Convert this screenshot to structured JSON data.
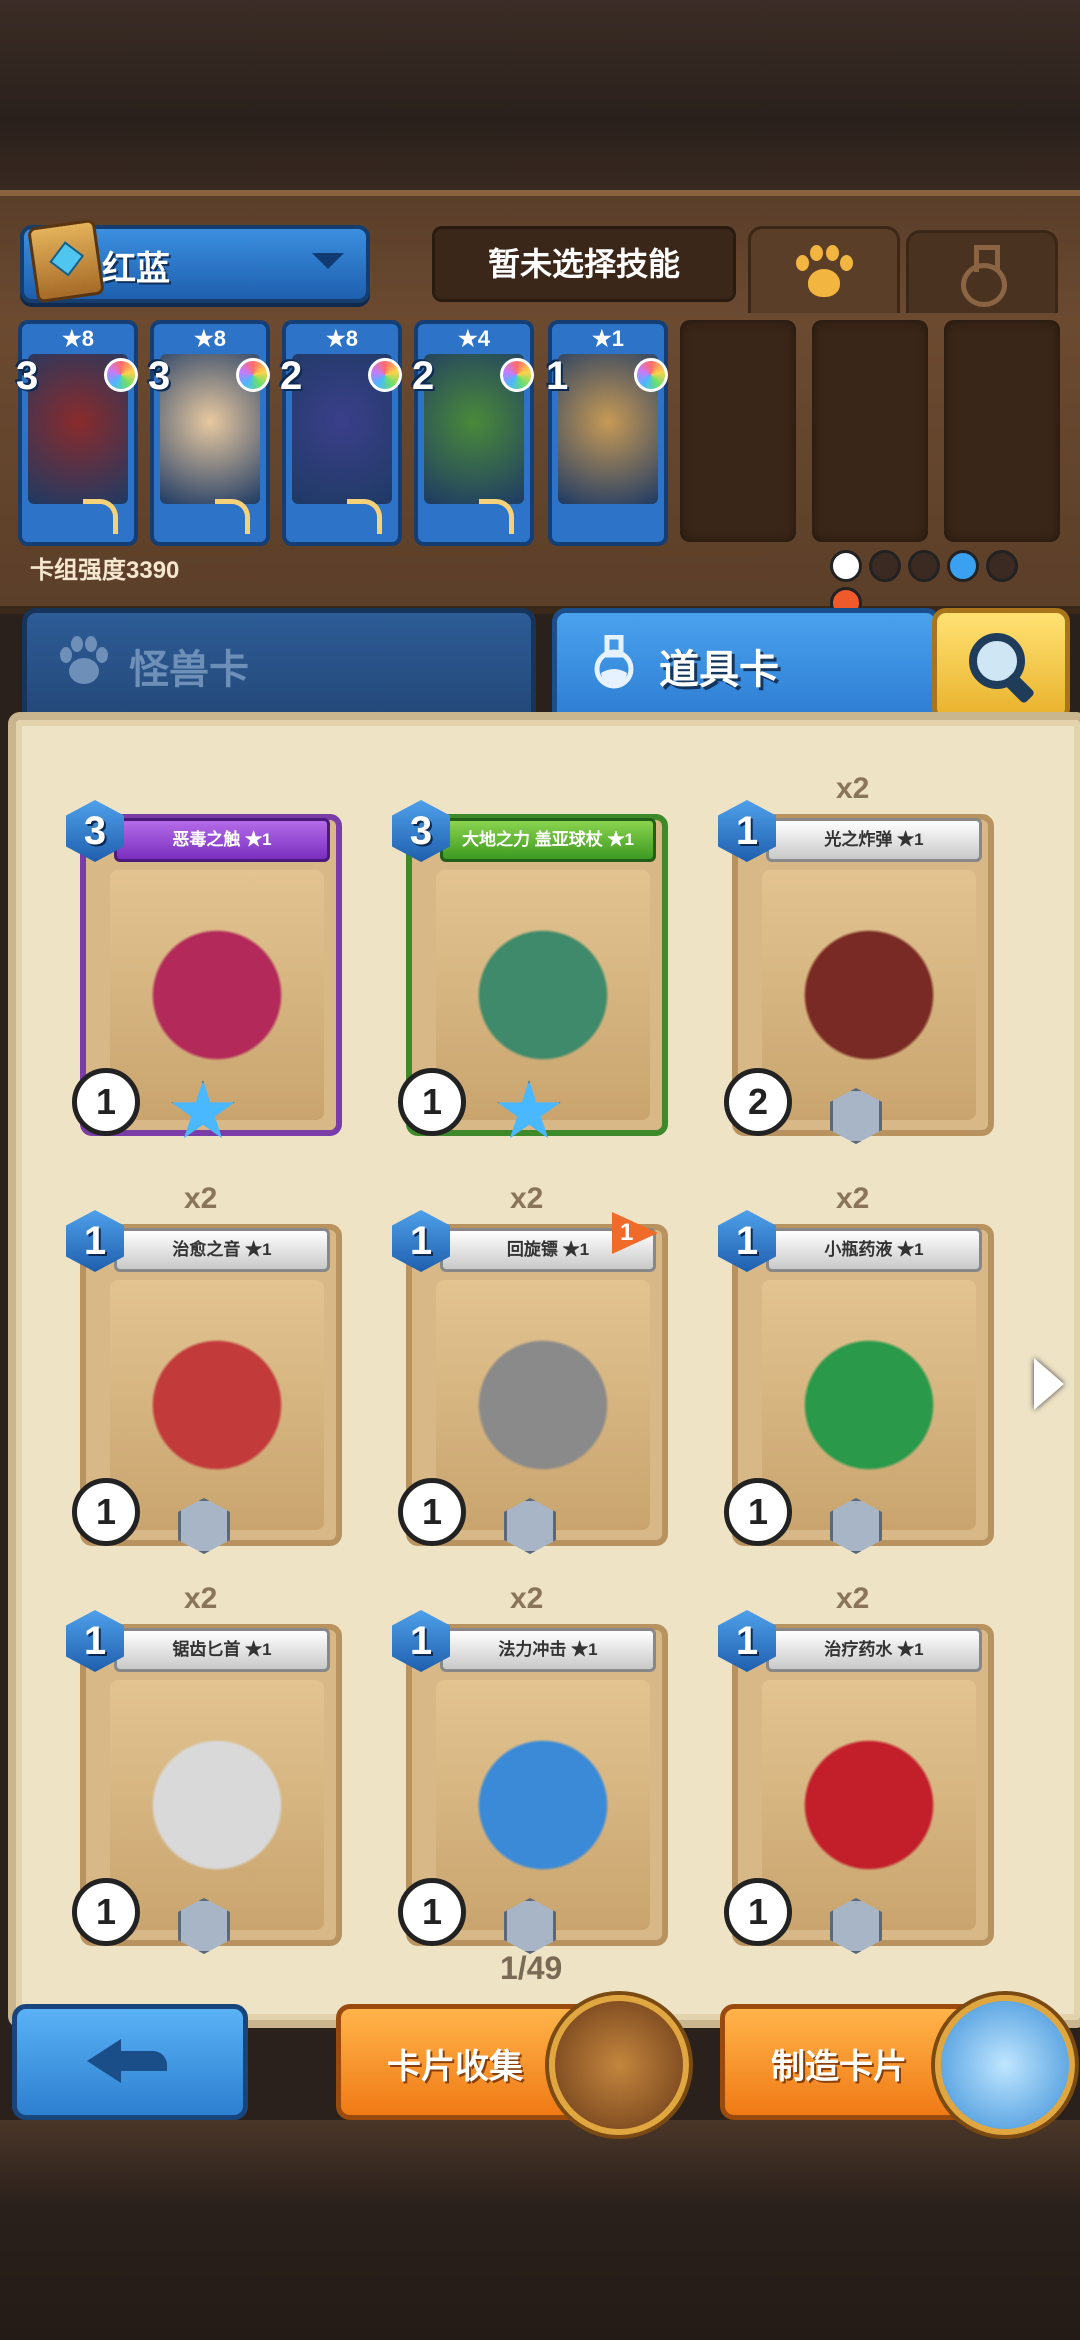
{
  "deck": {
    "name": "红蓝",
    "skill_label": "暂未选择技能",
    "power_label": "卡组强度3390",
    "cards": [
      {
        "stars": "★8",
        "cost": "3",
        "art": "#8a2b2b"
      },
      {
        "stars": "★8",
        "cost": "3",
        "art": "#e8c9a0"
      },
      {
        "stars": "★8",
        "cost": "2",
        "art": "#3b3f8a"
      },
      {
        "stars": "★4",
        "cost": "2",
        "art": "#4a8a3a"
      },
      {
        "stars": "★1",
        "cost": "1",
        "art": "#c79a55"
      }
    ],
    "elements_colors": [
      "#ffffff",
      "#3a2a22",
      "#3a2a22",
      "#3aa0f0",
      "#3a2a22",
      "#f05a2a"
    ]
  },
  "tabs": {
    "monster": "怪兽卡",
    "item": "道具卡"
  },
  "cards": [
    {
      "name": "恶毒之触 ★1",
      "cost": "3",
      "power": "1",
      "count": "",
      "ribbon": "purple",
      "art": "#b32a5a"
    },
    {
      "name": "大地之力 盖亚球杖 ★1",
      "cost": "3",
      "power": "1",
      "count": "",
      "ribbon": "green",
      "art": "#3e8a6a"
    },
    {
      "name": "光之炸弹 ★1",
      "cost": "1",
      "power": "2",
      "count": "x2",
      "ribbon": "white",
      "art": "#7a2a24"
    },
    {
      "name": "治愈之音 ★1",
      "cost": "1",
      "power": "1",
      "count": "x2",
      "ribbon": "white",
      "art": "#c23a3a"
    },
    {
      "name": "回旋镖 ★1",
      "cost": "1",
      "power": "1",
      "count": "x2",
      "ribbon": "white",
      "art": "#8a8a8a",
      "flag": "1"
    },
    {
      "name": "小瓶药液 ★1",
      "cost": "1",
      "power": "1",
      "count": "x2",
      "ribbon": "white",
      "art": "#2a9a4a"
    },
    {
      "name": "锯齿匕首 ★1",
      "cost": "1",
      "power": "1",
      "count": "x2",
      "ribbon": "white",
      "art": "#d9d9d9"
    },
    {
      "name": "法力冲击 ★1",
      "cost": "1",
      "power": "1",
      "count": "x2",
      "ribbon": "white",
      "art": "#3a8ad8"
    },
    {
      "name": "治疗药水 ★1",
      "cost": "1",
      "power": "1",
      "count": "x2",
      "ribbon": "white",
      "art": "#c21f2a"
    }
  ],
  "pagination": {
    "label": "1/49"
  },
  "buttons": {
    "back": "back",
    "collection": "卡片收集",
    "craft": "制造卡片"
  }
}
